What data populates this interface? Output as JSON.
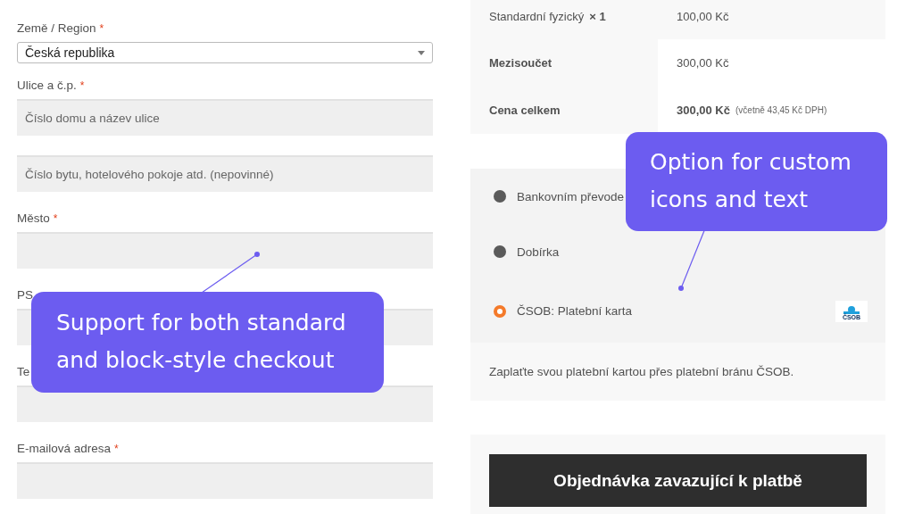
{
  "billing_fields": [
    {
      "kind": "select",
      "label": "Země / Region",
      "required_mark": "*",
      "value": "Česká republika"
    },
    {
      "kind": "input",
      "label": "Ulice a č.p.",
      "required_mark": "*",
      "placeholder": "Číslo domu a název ulice"
    },
    {
      "kind": "input",
      "placeholder": "Číslo bytu, hotelového pokoje atd. (nepovinné)"
    },
    {
      "kind": "input",
      "label": "Město",
      "required_mark": "*"
    },
    {
      "kind": "input",
      "label": "PS"
    },
    {
      "kind": "input",
      "label": "Te"
    },
    {
      "kind": "input",
      "label": "E-mailová adresa",
      "required_mark": "*"
    }
  ],
  "order_summary": [
    {
      "label": "Standardní fyzický",
      "quantity": "× 1",
      "value": "100,00 Kč",
      "emphasis": false
    },
    {
      "label": "Mezisoučet",
      "value": "300,00 Kč",
      "emphasis": true
    },
    {
      "label": "Cena celkem",
      "value": "300,00 Kč",
      "note": "(včetně 43,45 Kč DPH)",
      "emphasis": true
    }
  ],
  "payment_methods": [
    {
      "label": "Bankovním převode",
      "selected": false
    },
    {
      "label": "Dobírka",
      "selected": false
    },
    {
      "label": "ČSOB: Platební karta",
      "selected": true,
      "logo_text": "ČSOB"
    }
  ],
  "payment_description": "Zaplaťte svou platební kartou přes platební bránu ČSOB.",
  "place_order_button": "Objednávka zavazující k platbě",
  "callouts": [
    {
      "text": "Support for both standard and block-style checkout"
    },
    {
      "text": "Option for custom icons and text"
    }
  ]
}
